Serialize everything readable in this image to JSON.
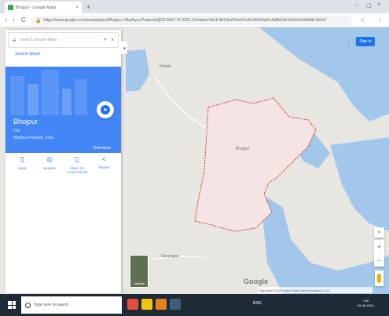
{
  "browser": {
    "tab_title": "Bhojpur - Google Maps",
    "tab_close": "×",
    "new_tab": "+",
    "window_controls": [
      "–",
      "▢",
      "×"
    ],
    "nav_buttons": [
      "‹",
      "›",
      "C"
    ],
    "url": "https://www.google.co.in/maps/place/Bhojpur,+Madhya+Pradesh/@23.0047,74.2023,12z/data=!3m1!4b1!4m5!3m4!1s0x39643ad5c5d8b23b:0x61b4c0b8d6c3e0a7",
    "omni_icons": [
      "☆",
      "⋮"
    ]
  },
  "panel": {
    "search_placeholder": "Search Google Maps",
    "search_menu": "≡",
    "search_icon": "⌕",
    "close_icon": "×",
    "side_link": "Send to phone",
    "place_title": "Bhojpur",
    "place_subtitle": "City",
    "place_subtitle2": "Madhya Pradesh, India",
    "directions_label": "Directions",
    "directions_icon": "➤",
    "actions": [
      {
        "icon": "▯",
        "label": "SAVE"
      },
      {
        "icon": "◎",
        "label": "NEARBY"
      },
      {
        "icon": "▯",
        "label": "SEND TO YOUR PHONE"
      },
      {
        "icon": "<",
        "label": "SHARE"
      }
    ],
    "collapse": "◂"
  },
  "map": {
    "labels": [
      "Bhojpur",
      "Kheda",
      "Sarangpur"
    ],
    "google_logo": "Google",
    "attribution": "Map data ©2020  India  Terms  Send feedback  2 km",
    "satellite_label": "Satellite",
    "apps_icon": "⋮⋮",
    "signin_label": "Sign in",
    "zoom_in": "+",
    "zoom_out": "−",
    "compass": "⌖",
    "colors": {
      "land": "#e8e6e1",
      "water": "#a3c7ea",
      "boundary": "#d93025",
      "highlight": "#f4e4e4"
    }
  },
  "taskbar": {
    "search_text": "Type here to search",
    "tray_text": "ENG",
    "clock_time": "7:55",
    "clock_date": "09-05-2020"
  }
}
